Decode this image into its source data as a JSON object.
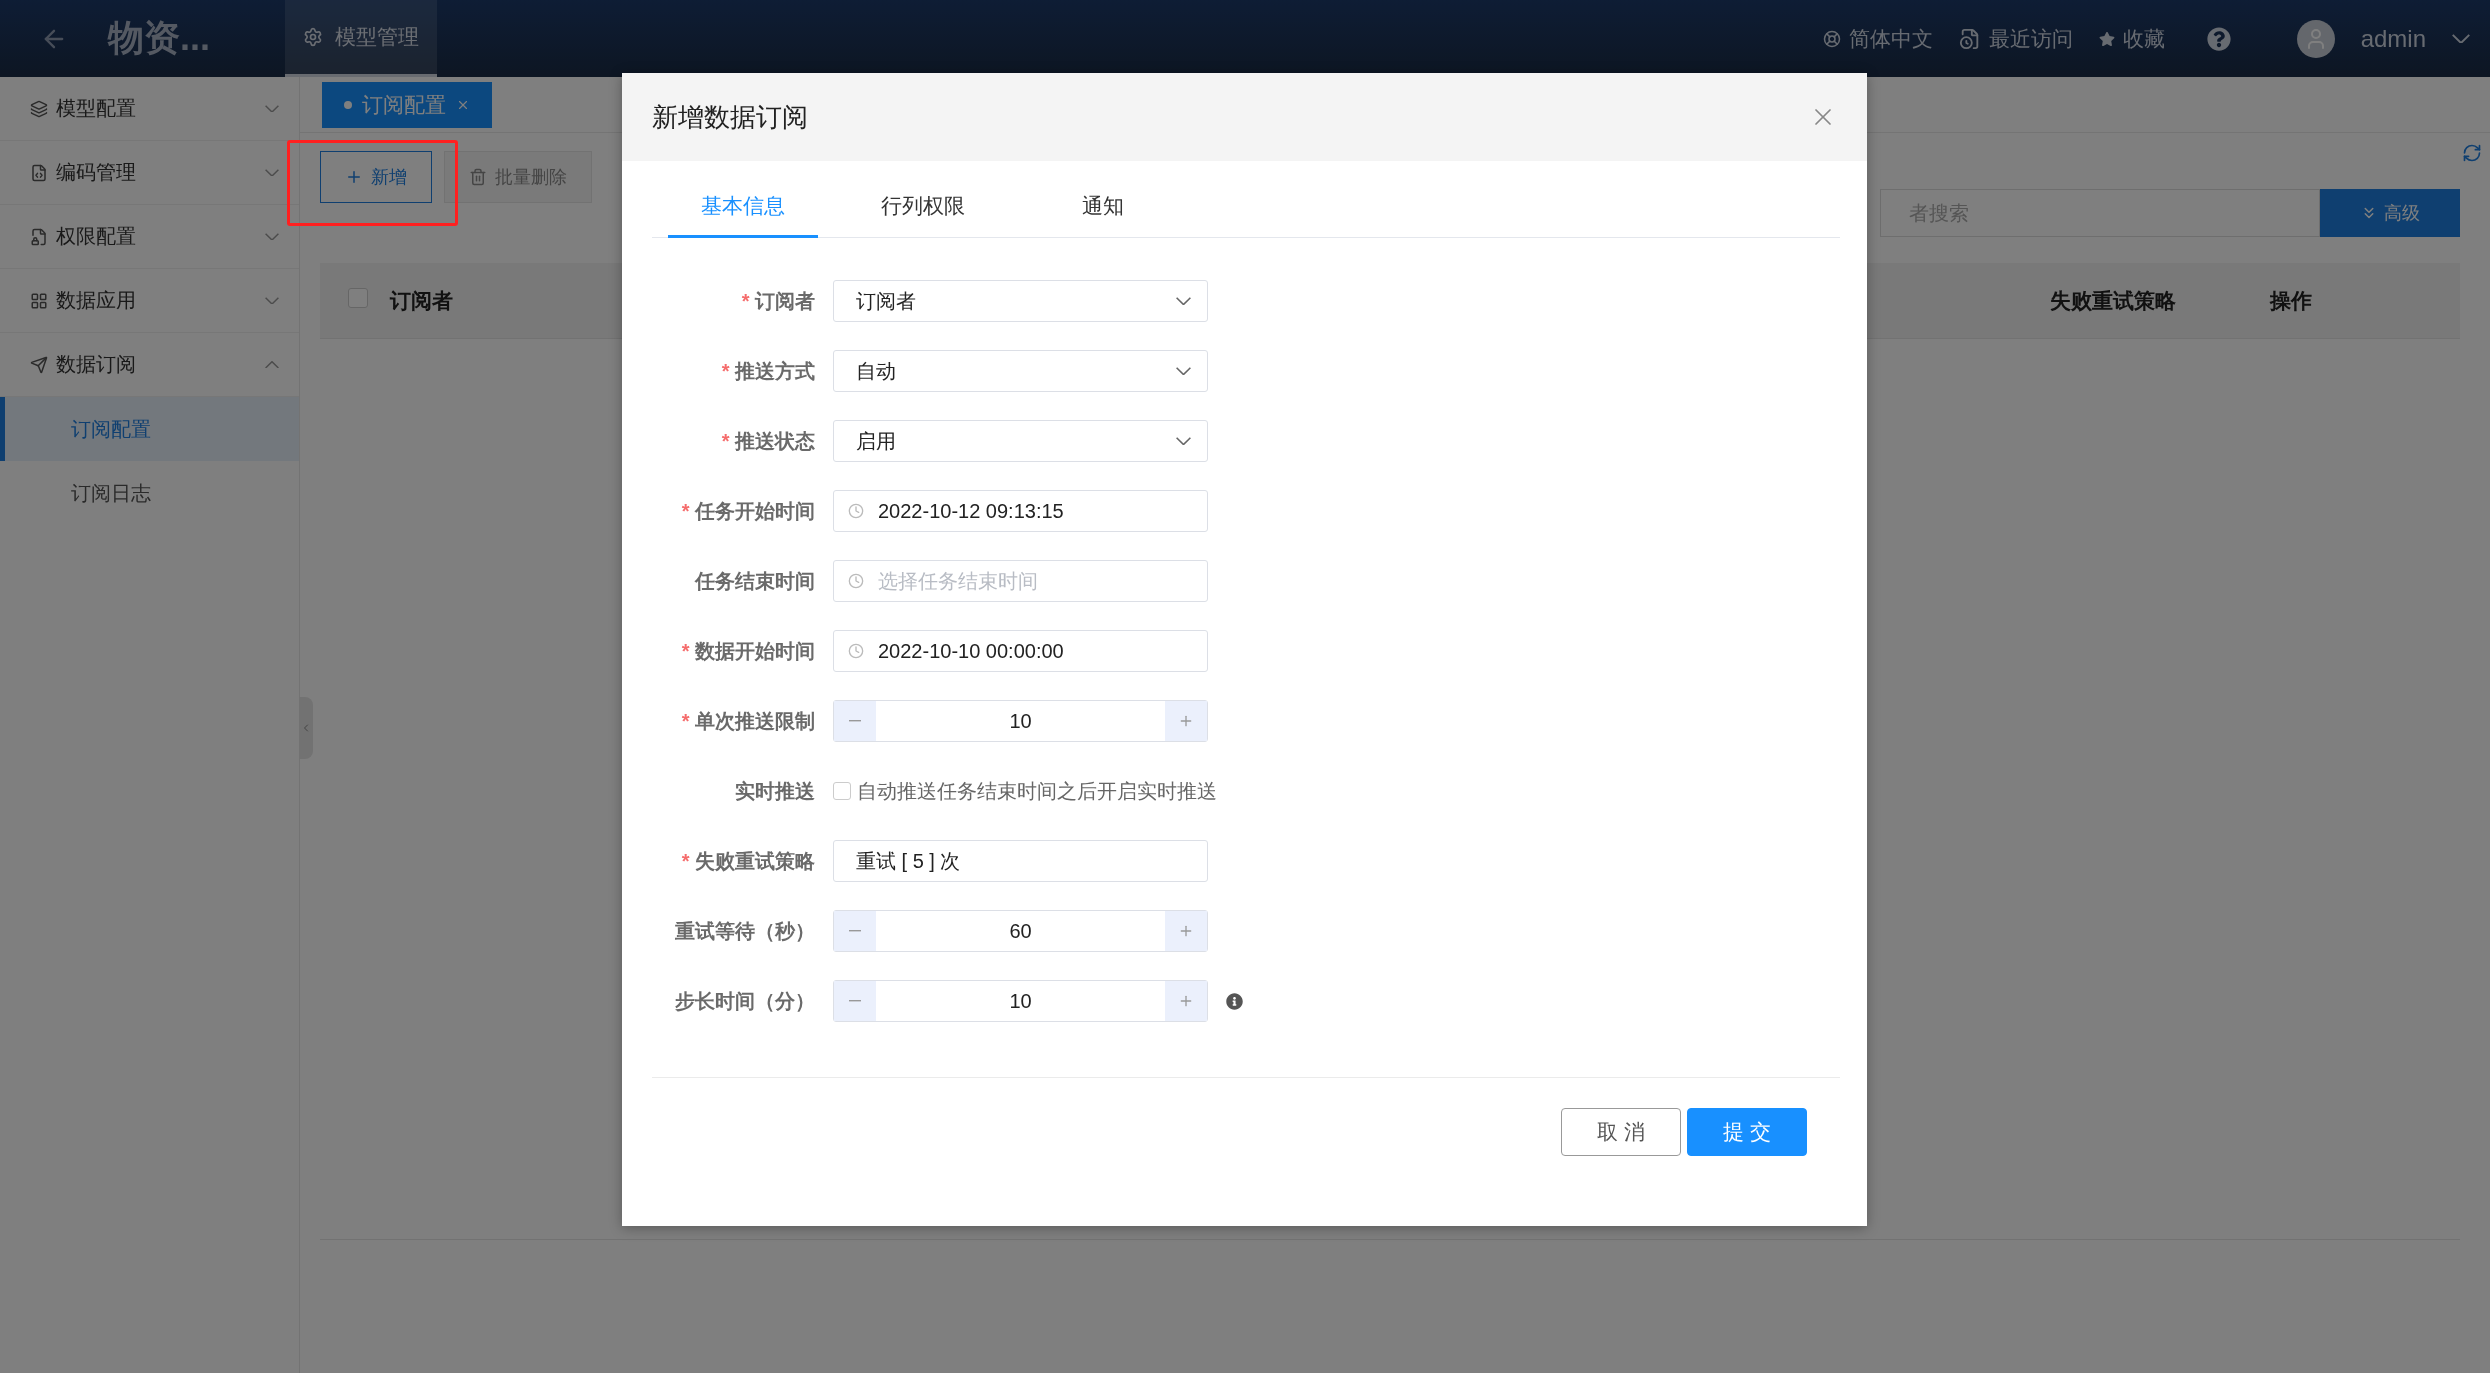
{
  "header": {
    "title": "物资...",
    "nav_tabs": [
      {
        "label": "模型管理",
        "selected": true
      }
    ],
    "language": "简体中文",
    "recent": "最近访问",
    "favorites": "收藏",
    "user": "admin"
  },
  "sidebar": {
    "items": [
      {
        "label": "模型配置",
        "expanded": false
      },
      {
        "label": "编码管理",
        "expanded": false
      },
      {
        "label": "权限配置",
        "expanded": false
      },
      {
        "label": "数据应用",
        "expanded": false
      },
      {
        "label": "数据订阅",
        "expanded": true,
        "children": [
          {
            "label": "订阅配置",
            "selected": true
          },
          {
            "label": "订阅日志",
            "selected": false
          }
        ]
      }
    ]
  },
  "page_tabs": [
    {
      "label": "订阅配置",
      "selected": true
    }
  ],
  "toolbar": {
    "buttons": [
      {
        "label": "新增",
        "kind": "add",
        "disabled": false
      },
      {
        "label": "批量删除",
        "kind": "delete",
        "disabled": true
      }
    ],
    "search": {
      "placeholder": "者搜索"
    },
    "advanced": "高级"
  },
  "table": {
    "select_all_checked": false,
    "columns": [
      {
        "label": "订阅者"
      },
      {
        "label": "失败重试策略"
      },
      {
        "label": "操作"
      }
    ]
  },
  "dialog": {
    "title": "新增数据订阅",
    "tabs": [
      {
        "label": "基本信息",
        "selected": true
      },
      {
        "label": "行列权限",
        "selected": false
      },
      {
        "label": "通知",
        "selected": false
      }
    ],
    "fields": [
      {
        "kind": "select",
        "mark": "*",
        "label": "订阅者",
        "value": "订阅者"
      },
      {
        "kind": "select",
        "mark": "*",
        "label": "推送方式",
        "value": "自动"
      },
      {
        "kind": "select",
        "mark": "*",
        "label": "推送状态",
        "value": "启用"
      },
      {
        "kind": "datetime",
        "mark": "*",
        "label": "任务开始时间",
        "value": "2022-10-12 09:13:15"
      },
      {
        "kind": "datetime",
        "label": "任务结束时间",
        "placeholder": "选择任务结束时间"
      },
      {
        "kind": "datetime",
        "mark": "*",
        "label": "数据开始时间",
        "value": "2022-10-10 00:00:00"
      },
      {
        "kind": "number",
        "mark": "*",
        "label": "单次推送限制",
        "value": "10"
      },
      {
        "kind": "checkbox",
        "label": "实时推送",
        "checked": false,
        "text": "自动推送任务结束时间之后开启实时推送"
      },
      {
        "kind": "text",
        "mark": "*",
        "label": "失败重试策略",
        "value": "重试 [ 5 ] 次"
      },
      {
        "kind": "number",
        "label": "重试等待（秒）",
        "value": "60"
      },
      {
        "kind": "number",
        "label": "步长时间（分）",
        "value": "10",
        "info": true
      }
    ],
    "buttons": [
      {
        "label": "取 消",
        "kind": "default"
      },
      {
        "label": "提 交",
        "kind": "primary"
      }
    ]
  }
}
